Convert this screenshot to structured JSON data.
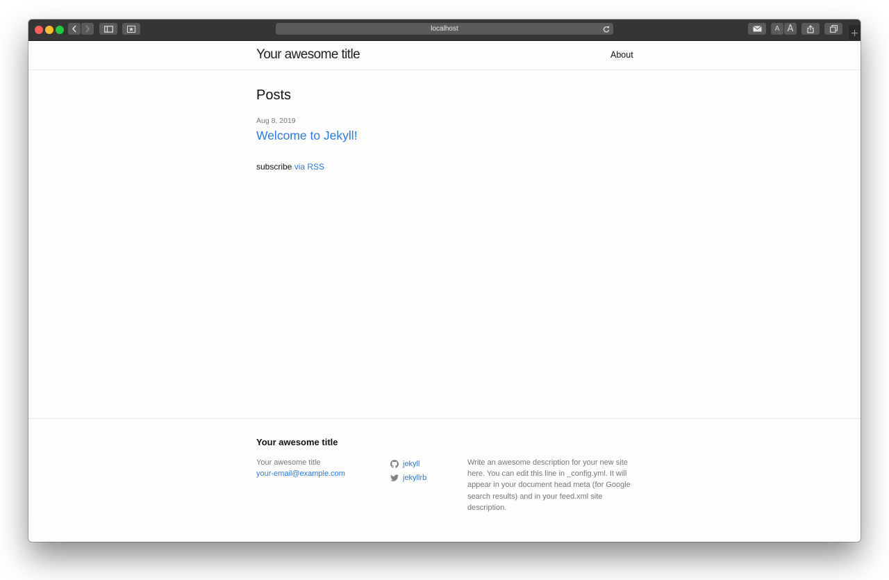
{
  "browser": {
    "url": "localhost"
  },
  "site": {
    "title": "Your awesome title",
    "nav": {
      "about": "About"
    }
  },
  "main": {
    "heading": "Posts",
    "posts": [
      {
        "date": "Aug 8, 2019",
        "title": "Welcome to Jekyll!"
      }
    ],
    "subscribe_label": "subscribe",
    "subscribe_link": "via RSS"
  },
  "footer": {
    "heading": "Your awesome title",
    "name": "Your awesome title",
    "email": "your-email@example.com",
    "social": [
      {
        "icon": "github-icon",
        "label": "jekyll"
      },
      {
        "icon": "twitter-icon",
        "label": "jekyllrb"
      }
    ],
    "description": "Write an awesome description for your new site here. You can edit this line in _config.yml. It will appear in your document head meta (for Google search results) and in your feed.xml site description."
  },
  "colors": {
    "link": "#2a7ae2",
    "toolbar": "#353535"
  }
}
